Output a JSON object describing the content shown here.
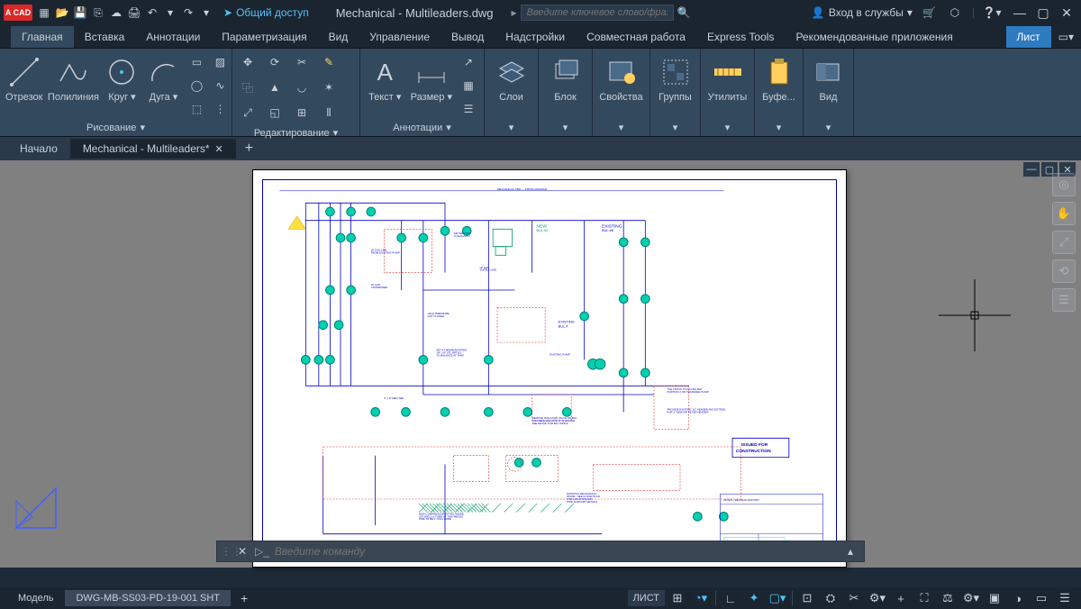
{
  "app_badge": "A CAD",
  "share_label": "Общий доступ",
  "title": "Mechanical - Multileaders.dwg",
  "search_placeholder": "Введите ключевое слово/фразу",
  "signin_label": "Вход в службы",
  "ribbon_tabs": {
    "home": "Главная",
    "insert": "Вставка",
    "annotate": "Аннотации",
    "parametric": "Параметризация",
    "view": "Вид",
    "manage": "Управление",
    "output": "Вывод",
    "addins": "Надстройки",
    "collab": "Совместная работа",
    "express": "Express Tools",
    "featured": "Рекомендованные приложения",
    "layout": "Лист"
  },
  "panels": {
    "draw": {
      "label": "Рисование",
      "line": "Отрезок",
      "polyline": "Полилиния",
      "circle": "Круг",
      "arc": "Дуга"
    },
    "modify": {
      "label": "Редактирование"
    },
    "annotation": {
      "label": "Аннотации",
      "text": "Текст",
      "dimension": "Размер"
    },
    "layers": {
      "label": "Слои"
    },
    "block": {
      "label": "Блок"
    },
    "properties": {
      "label": "Свойства"
    },
    "groups": {
      "label": "Группы"
    },
    "utilities": {
      "label": "Утилиты"
    },
    "clipboard": {
      "label": "Буфе..."
    },
    "viewpanel": {
      "label": "Вид"
    }
  },
  "filetabs": {
    "start": "Начало",
    "active": "Mechanical - Multileaders*"
  },
  "cmd_placeholder": "Введите команду",
  "layout_tabs": {
    "model": "Модель",
    "sheet": "DWG-MB-SS03-PD-19-001 SHT"
  },
  "status": {
    "list_label": "ЛИСТ"
  },
  "drawing": {
    "stamp": "ISSUED FOR\nCONSTRUCTION",
    "labels": {
      "new": "NEW BUL.#9",
      "existing": "EXISTING BUL.#8"
    }
  }
}
